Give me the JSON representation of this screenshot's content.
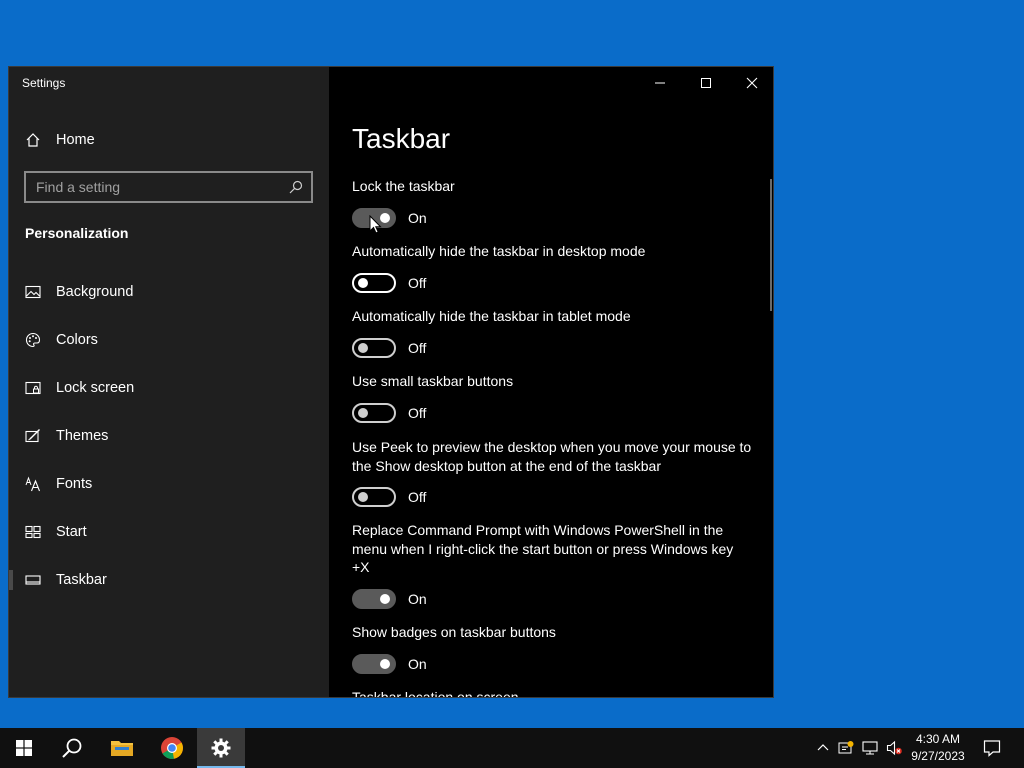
{
  "window": {
    "title": "Settings",
    "home_label": "Home",
    "search": {
      "placeholder": "Find a setting",
      "value": ""
    },
    "section": "Personalization",
    "nav": [
      {
        "label": "Background",
        "icon": "picture-icon"
      },
      {
        "label": "Colors",
        "icon": "palette-icon"
      },
      {
        "label": "Lock screen",
        "icon": "lock-screen-icon"
      },
      {
        "label": "Themes",
        "icon": "themes-icon"
      },
      {
        "label": "Fonts",
        "icon": "fonts-icon"
      },
      {
        "label": "Start",
        "icon": "start-icon"
      },
      {
        "label": "Taskbar",
        "icon": "taskbar-icon",
        "active": true
      }
    ]
  },
  "content": {
    "title": "Taskbar",
    "settings": [
      {
        "label": "Lock the taskbar",
        "state": "On"
      },
      {
        "label": "Automatically hide the taskbar in desktop mode",
        "state": "Off"
      },
      {
        "label": "Automatically hide the taskbar in tablet mode",
        "state": "Off"
      },
      {
        "label": "Use small taskbar buttons",
        "state": "Off"
      },
      {
        "label": "Use Peek to preview the desktop when you move your mouse to the Show desktop button at the end of the taskbar",
        "state": "Off"
      },
      {
        "label": "Replace Command Prompt with Windows PowerShell in the menu when I right-click the start button or press Windows key +X",
        "state": "On"
      },
      {
        "label": "Show badges on taskbar buttons",
        "state": "On"
      }
    ],
    "partial_next": "Taskbar location on screen"
  },
  "taskbar": {
    "clock": {
      "time": "4:30 AM",
      "date": "9/27/2023"
    },
    "apps": [
      "start-icon",
      "search-icon",
      "file-explorer-icon",
      "chrome-icon",
      "settings-icon"
    ]
  },
  "colors": {
    "desktop": "#0a6cc9",
    "sidebar": "#1f1f1f",
    "content": "#000000",
    "accent_underline": "#76b9ed"
  }
}
